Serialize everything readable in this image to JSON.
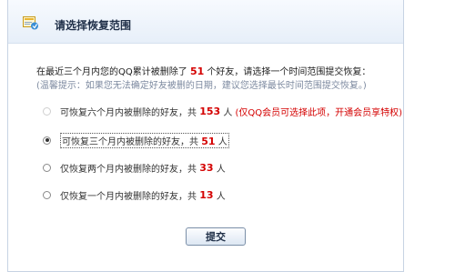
{
  "header": {
    "title": "请选择恢复范围",
    "icon": "restore-icon"
  },
  "summary": {
    "prefix": "在最近三个月内您的QQ累计被删除了",
    "count": "51",
    "suffix": "个好友，请选择一个时间范围提交恢复："
  },
  "tip": "(温馨提示：如果您无法确定好友被删的日期，建议您选择最长时间范围提交恢复。)",
  "options": [
    {
      "label": "可恢复六个月内被删除的好友，共",
      "count": "153",
      "unit": "人",
      "note": "(仅QQ会员可选择此项，开通会员享特权)",
      "selected": false,
      "disabled": true
    },
    {
      "label": "可恢复三个月内被删除的好友，共",
      "count": "51",
      "unit": "人",
      "note": "",
      "selected": true,
      "disabled": false
    },
    {
      "label": "仅恢复两个月内被删除的好友，共",
      "count": "33",
      "unit": "人",
      "note": "",
      "selected": false,
      "disabled": false
    },
    {
      "label": "仅恢复一个月内被删除的好友，共",
      "count": "13",
      "unit": "人",
      "note": "",
      "selected": false,
      "disabled": false
    }
  ],
  "submit_label": "提交",
  "colors": {
    "accent_red": "#d40000",
    "header_bg": "#e7eff9",
    "border": "#c7d3e3"
  }
}
